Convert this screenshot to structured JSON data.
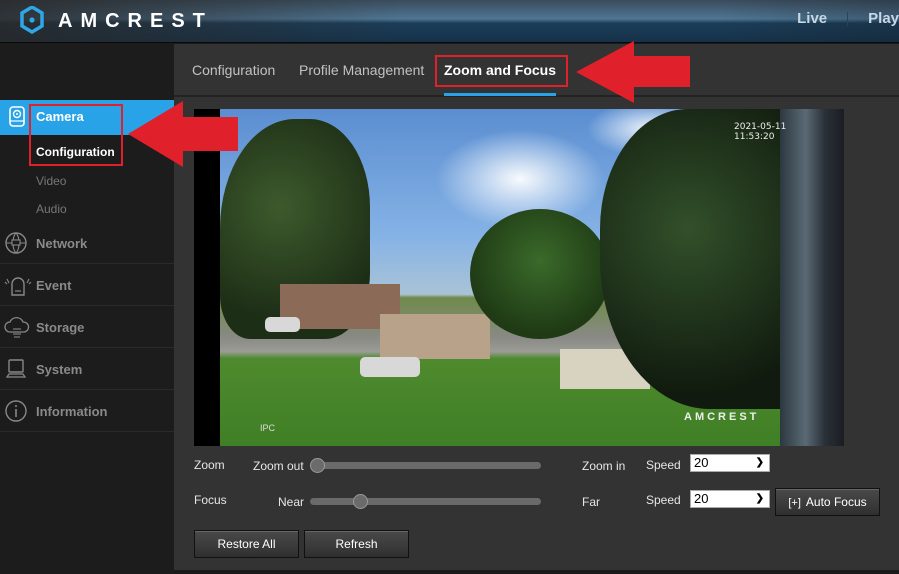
{
  "header": {
    "brand": "AMCREST",
    "nav": [
      "Live",
      "Play"
    ]
  },
  "sidebar": {
    "section": {
      "label": "Camera",
      "icon": "camera-icon"
    },
    "subitems": [
      {
        "label": "Configuration",
        "active": true
      },
      {
        "label": "Video",
        "active": false
      },
      {
        "label": "Audio",
        "active": false
      }
    ],
    "items": [
      {
        "label": "Network",
        "icon": "network-globe-icon"
      },
      {
        "label": "Event",
        "icon": "alarm-icon"
      },
      {
        "label": "Storage",
        "icon": "cloud-storage-icon"
      },
      {
        "label": "System",
        "icon": "computer-icon"
      },
      {
        "label": "Information",
        "icon": "info-icon"
      }
    ]
  },
  "tabs": [
    {
      "label": "Configuration",
      "active": false
    },
    {
      "label": "Profile Management",
      "active": false
    },
    {
      "label": "Zoom and Focus",
      "active": true
    }
  ],
  "video": {
    "timestamp": "2021-05-11 11:53:20",
    "channel_label": "IPC",
    "watermark": "AMCREST"
  },
  "controls": {
    "zoom": {
      "label": "Zoom",
      "min_label": "Zoom out",
      "max_label": "Zoom in",
      "value_fraction": 0.0,
      "speed_label": "Speed",
      "speed_value": "20"
    },
    "focus": {
      "label": "Focus",
      "min_label": "Near",
      "max_label": "Far",
      "value_fraction": 0.2,
      "speed_label": "Speed",
      "speed_value": "20",
      "auto_focus_label": "Auto Focus"
    },
    "restore_all_label": "Restore All",
    "refresh_label": "Refresh"
  },
  "colors": {
    "accent": "#29a3e8",
    "annotation_red": "#e0202a"
  }
}
